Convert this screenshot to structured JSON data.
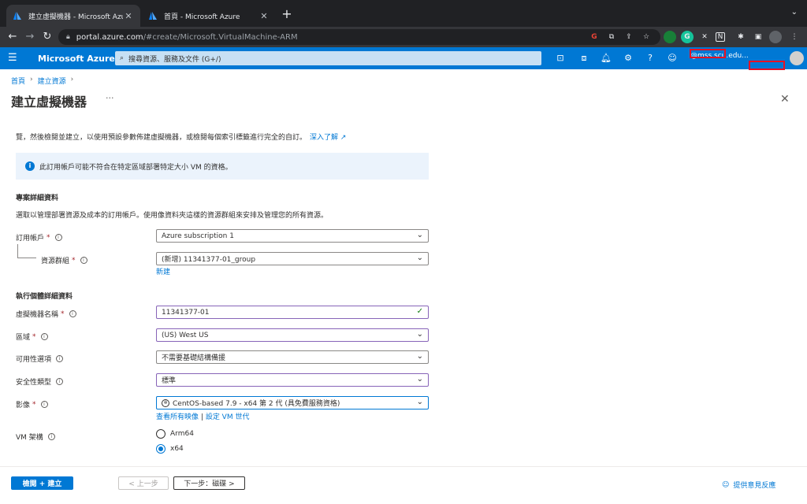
{
  "browser": {
    "tabs": [
      {
        "title": "建立虛擬機器 - Microsoft Azure",
        "close": "✕"
      },
      {
        "title": "首頁 - Microsoft Azure",
        "close": "✕"
      }
    ],
    "new_tab": "+",
    "url_host": "portal.azure.com",
    "url_path": "/#create/Microsoft.VirtualMachine-ARM"
  },
  "header": {
    "brand": "Microsoft Azure",
    "search_placeholder": "搜尋資源、服務及文件 (G+/)",
    "account": "@mss.scu.edu..."
  },
  "breadcrumb": [
    "首頁",
    "建立資源"
  ],
  "page": {
    "title": "建立虛擬機器",
    "more": "···",
    "intro_text": "覽，然後檢閱並建立，以使用預設參數佈建虛擬機器，或檢閱每個索引標籤進行完全的自訂。",
    "intro_link": "深入了解 ↗",
    "info_text": "此訂用帳戶可能不符合在特定區域部署特定大小 VM 的資格。"
  },
  "project_section": {
    "heading": "專案詳細資料",
    "description": "選取以管理部署資源及成本的訂用帳戶。使用像資料夾這樣的資源群組來安排及管理您的所有資源。",
    "subscription_label": "訂用帳戶",
    "subscription_value": "Azure subscription 1",
    "resource_group_label": "資源群組",
    "resource_group_value": "(新增) 11341377-01_group",
    "create_new_link": "新建"
  },
  "instance_section": {
    "heading": "執行個體詳細資料",
    "vm_name_label": "虛擬機器名稱",
    "vm_name_value": "11341377-01",
    "region_label": "區域",
    "region_value": "(US) West US",
    "availability_label": "可用性選項",
    "availability_value": "不需要基礎結構備援",
    "security_label": "安全性類型",
    "security_value": "標準",
    "image_label": "影像",
    "image_value": "CentOS-based 7.9 - x64 第 2 代 (具免費服務資格)",
    "see_all_images": "查看所有映像",
    "link_divider": "|",
    "configure_vm_generation": "設定 VM 世代",
    "arch_label": "VM 架構",
    "arch_options": [
      "Arm64",
      "x64"
    ],
    "arch_selected": "x64"
  },
  "footer": {
    "review_create": "檢閱 + 建立",
    "previous": "< 上一步",
    "next": "下一步：磁碟 >",
    "feedback": "提供意見反應"
  },
  "colors": {
    "azure_blue": "#0078d4",
    "required_red": "#a4262c",
    "focus_purple": "#8764b8",
    "annotation_red": "#e81123"
  }
}
